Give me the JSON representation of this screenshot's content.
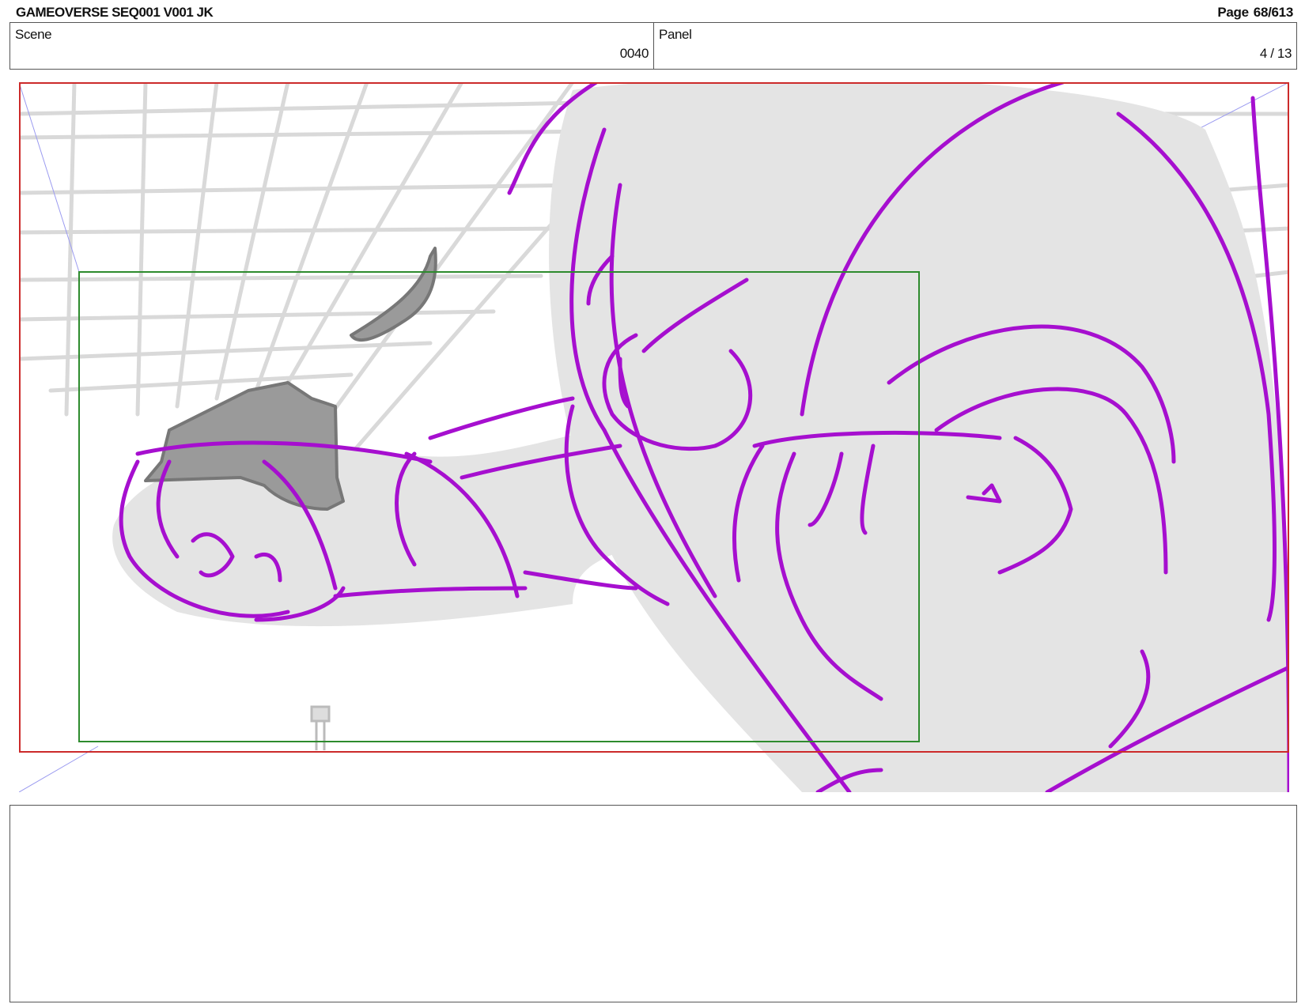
{
  "header": {
    "title": "GAMEOVERSE SEQ001 V001 JK",
    "page_label": "Page",
    "page_value": "68/613"
  },
  "info": {
    "scene_label": "Scene",
    "scene_value": "0040",
    "panel_label": "Panel",
    "panel_value": "4 / 13"
  },
  "colors": {
    "frame_border": "#cc2a2a",
    "safe_area": "#2e8b2e",
    "sketch": "#a60fcf",
    "fill_light": "#e4e4e4",
    "fill_dark": "#9a9a9a",
    "grid": "#d8d8d8"
  },
  "notes": {
    "text": ""
  }
}
